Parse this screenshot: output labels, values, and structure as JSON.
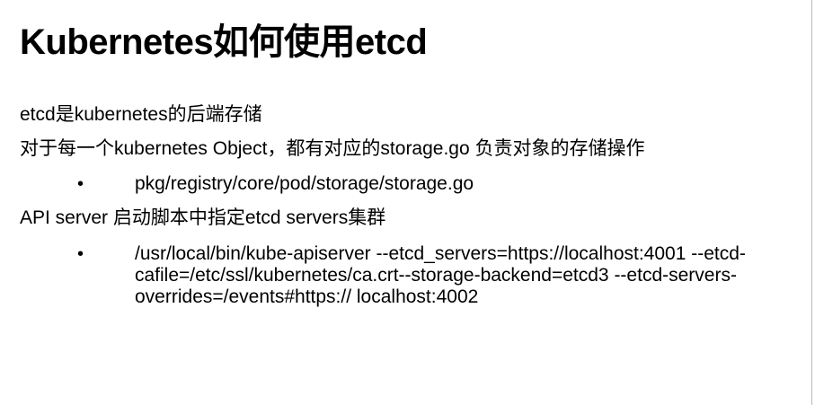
{
  "title": "Kubernetes如何使用etcd",
  "lines": [
    "etcd是kubernetes的后端存储",
    "对于每一个kubernetes Object，都有对应的storage.go 负责对象的存储操作",
    "pkg/registry/core/pod/storage/storage.go",
    "API server 启动脚本中指定etcd servers集群"
  ],
  "command_lines": [
    "/usr/local/bin/kube-apiserver --etcd_servers=https://localhost:4001 --etcd-",
    "cafile=/etc/ssl/kubernetes/ca.crt--storage-backend=etcd3  --etcd-servers-",
    "overrides=/events#https:// localhost:4002"
  ],
  "bullet": "•"
}
